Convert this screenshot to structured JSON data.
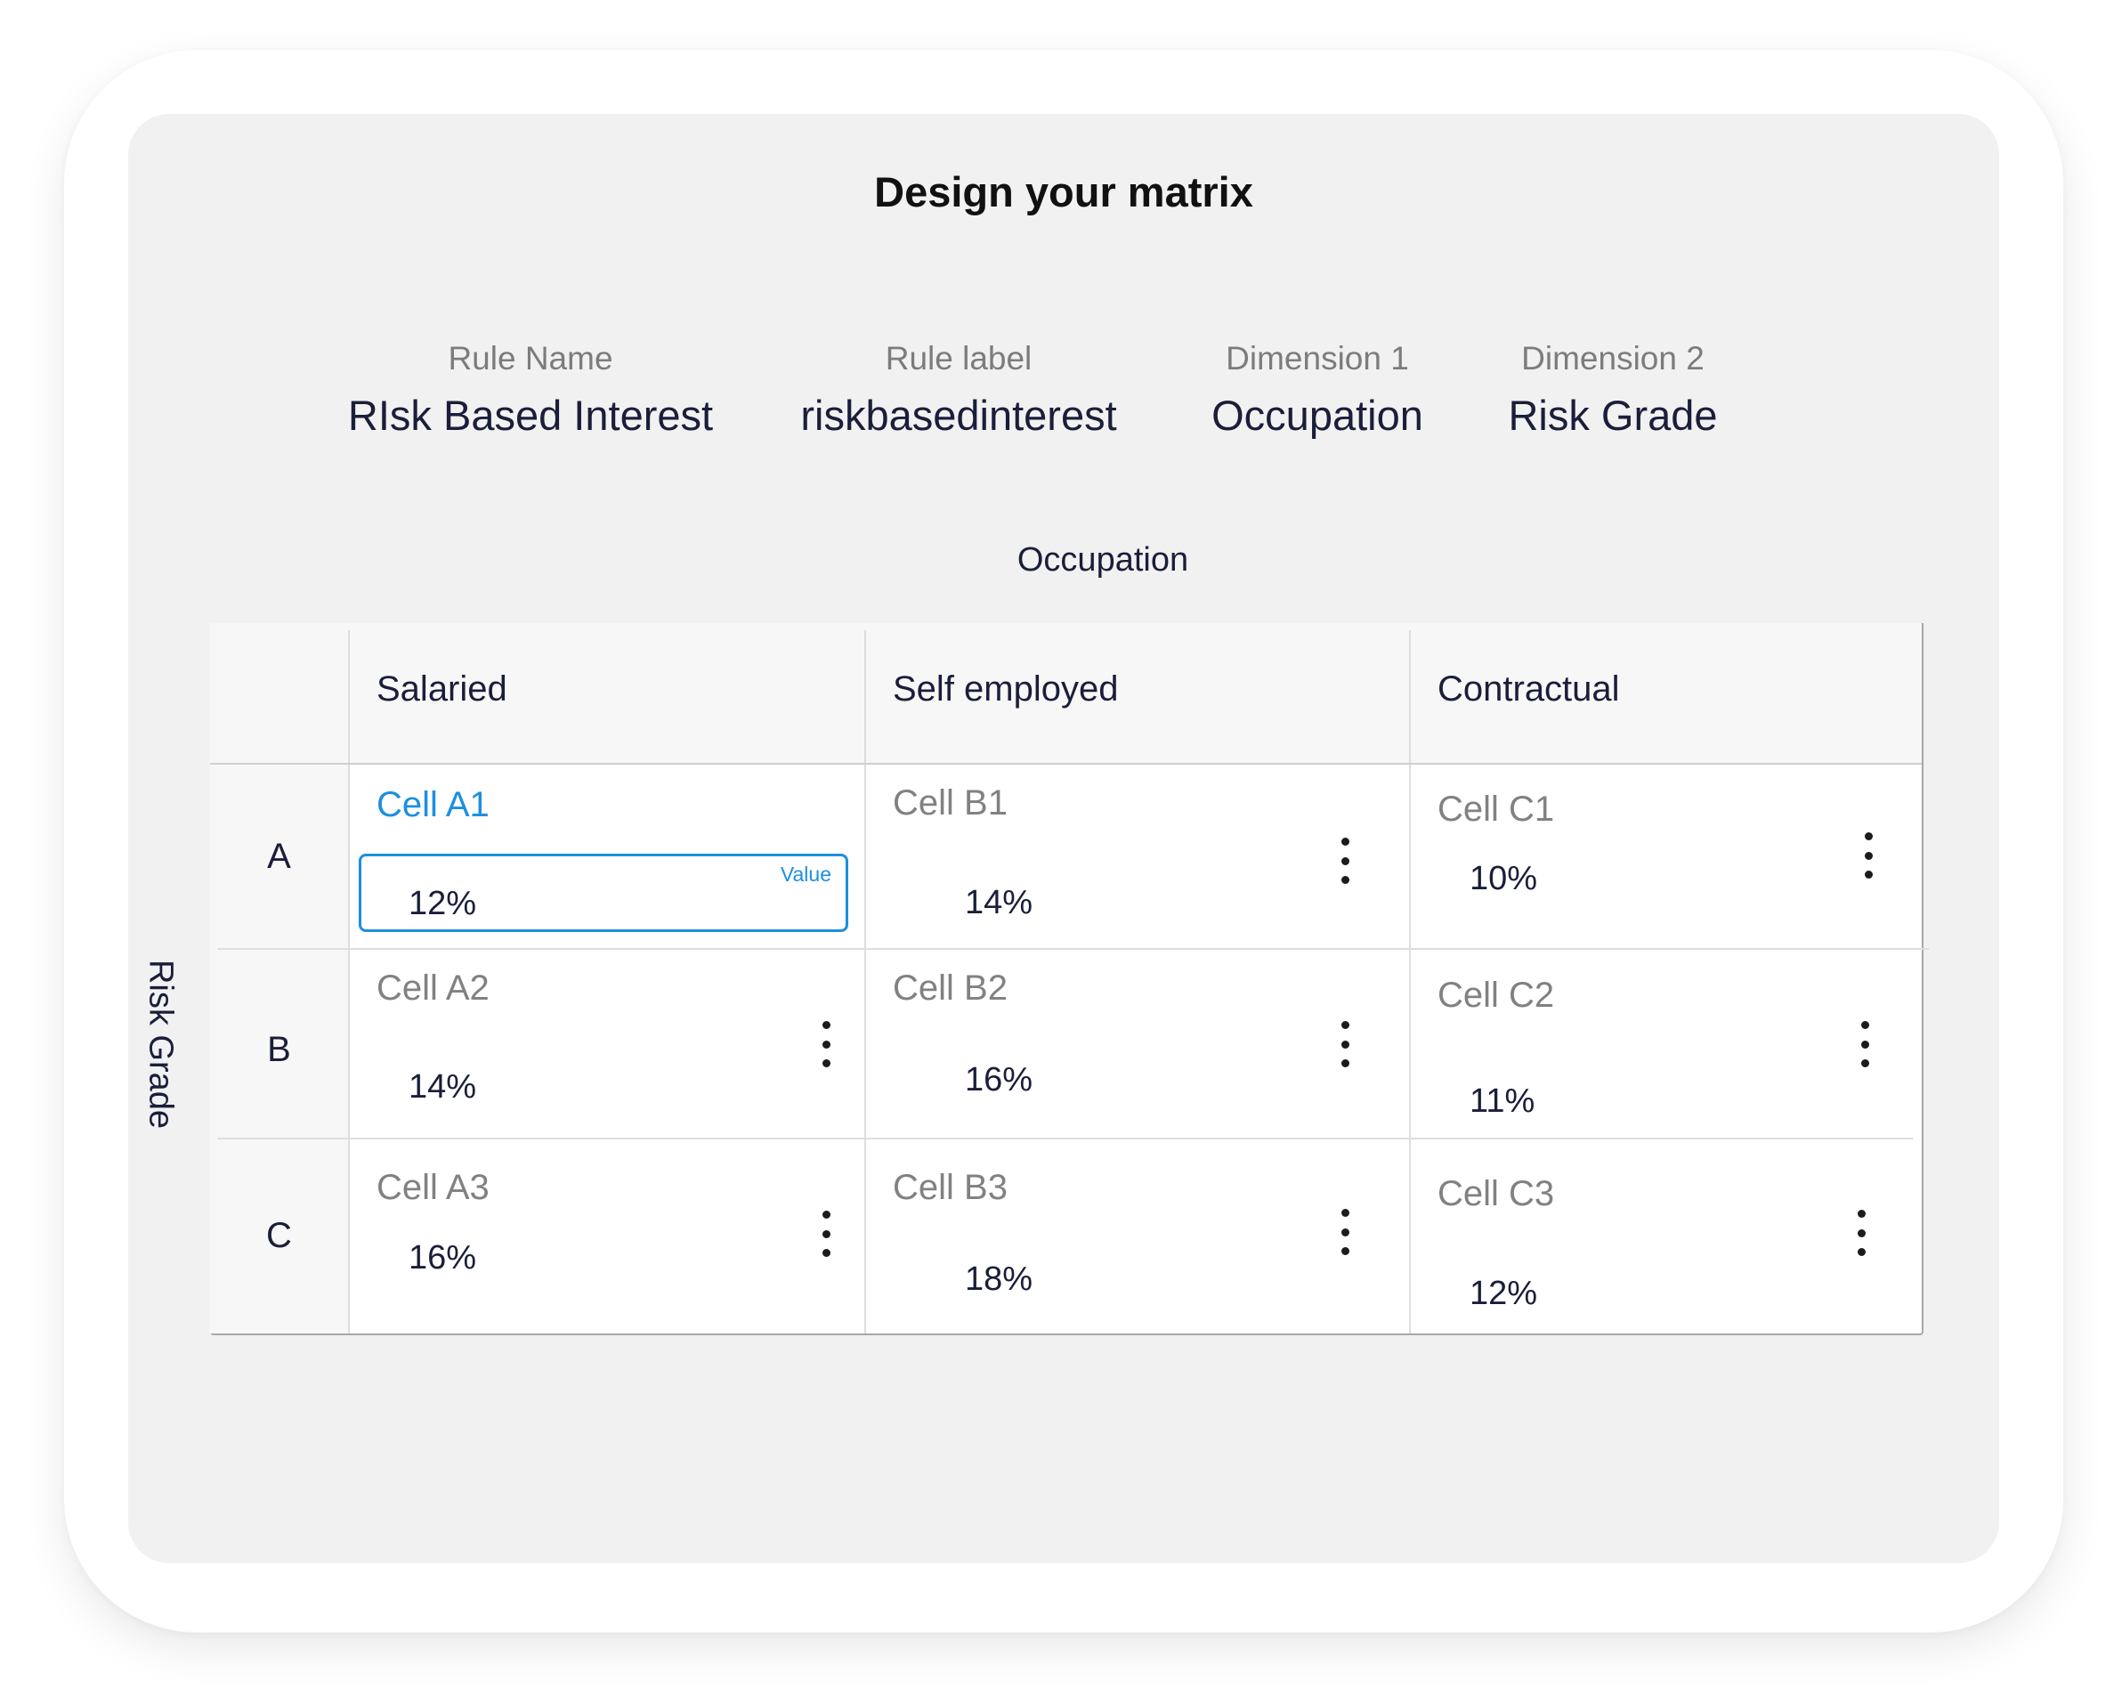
{
  "title": "Design your matrix",
  "meta": [
    {
      "label": "Rule Name",
      "value": "RIsk Based Interest"
    },
    {
      "label": "Rule label",
      "value": "riskbasedinterest"
    },
    {
      "label": "Dimension 1",
      "value": "Occupation"
    },
    {
      "label": "Dimension 2",
      "value": "Risk Grade"
    }
  ],
  "axis": {
    "columns_title": "Occupation",
    "rows_title": "Risk Grade"
  },
  "columns": [
    "Salaried",
    "Self employed",
    "Contractual"
  ],
  "rows": [
    "A",
    "B",
    "C"
  ],
  "cells": {
    "a1": {
      "name": "Cell A1",
      "value": "12%",
      "field_label": "Value",
      "editing": true
    },
    "b1": {
      "name": "Cell B1",
      "value": "14%"
    },
    "c1": {
      "name": "Cell C1",
      "value": "10%"
    },
    "a2": {
      "name": "Cell A2",
      "value": "14%"
    },
    "b2": {
      "name": "Cell B2",
      "value": "16%"
    },
    "c2": {
      "name": "Cell C2",
      "value": "11%"
    },
    "a3": {
      "name": "Cell A3",
      "value": "16%"
    },
    "b3": {
      "name": "Cell B3",
      "value": "18%"
    },
    "c3": {
      "name": "Cell C3",
      "value": "12%"
    }
  },
  "icons": {
    "cell_menu": "more-vertical-icon"
  },
  "colors": {
    "accent": "#1d8fe1",
    "text_primary": "#1a1e3a",
    "text_muted": "#818181",
    "panel_bg": "#f1f1f1"
  }
}
